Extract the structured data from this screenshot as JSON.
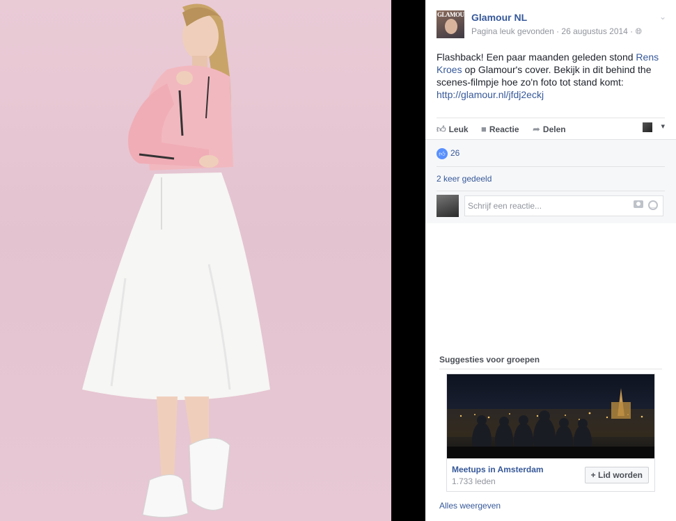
{
  "post": {
    "page_name": "Glamour NL",
    "avatar_masthead": "GLAMOUR",
    "meta_text": "Pagina leuk gevonden · 26 augustus 2014 ·",
    "text_before_link1": "Flashback! Een paar maanden geleden stond ",
    "link1": "Rens Kroes",
    "text_after_link1": " op Glamour's cover. Bekijk in dit behind the scenes-filmpje hoe zo'n foto tot stand komt: ",
    "url": "http://glamour.nl/jfdj2eckj"
  },
  "actions": {
    "like": "Leuk",
    "comment": "Reactie",
    "share": "Delen"
  },
  "stats": {
    "likes_count": "26",
    "shares_text": "2 keer gedeeld"
  },
  "comment": {
    "placeholder": "Schrijf een reactie..."
  },
  "suggestions": {
    "title": "Suggesties voor groepen",
    "group_name": "Meetups in Amsterdam",
    "members": "1.733 leden",
    "join_label": "+ Lid worden",
    "show_all": "Alles weergeven"
  },
  "colors": {
    "link": "#365899",
    "like_blue": "#5890ff",
    "photo_bg": "#e7c8d4"
  }
}
